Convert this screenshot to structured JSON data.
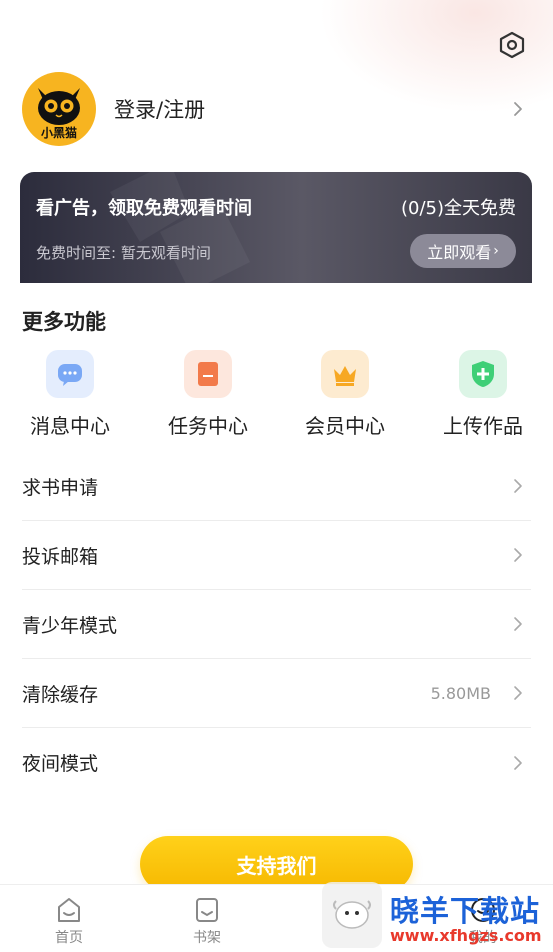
{
  "profile": {
    "avatar_text": "小黑猫",
    "login_label": "登录/注册"
  },
  "icons": {
    "settings": "hexagon-settings-icon",
    "chevron": "chevron-right-icon"
  },
  "ad_card": {
    "title": "看广告，领取免费观看时间",
    "free_count": "(0/5)全天免费",
    "subtitle": "免费时间至: 暂无观看时间",
    "button_label": "立即观看",
    "button_arrow": "›"
  },
  "more_features": {
    "title": "更多功能",
    "items": [
      {
        "label": "消息中心",
        "icon": "message-icon",
        "color": "#7aa8f5",
        "bg": "#e4edfd"
      },
      {
        "label": "任务中心",
        "icon": "task-icon",
        "color": "#f27a4a",
        "bg": "#fde7dd"
      },
      {
        "label": "会员中心",
        "icon": "crown-icon",
        "color": "#f7a823",
        "bg": "#fdebd0"
      },
      {
        "label": "上传作品",
        "icon": "upload-shield-icon",
        "color": "#3fcf77",
        "bg": "#dcf5e6"
      }
    ]
  },
  "menu": [
    {
      "label": "求书申请",
      "value": ""
    },
    {
      "label": "投诉邮箱",
      "value": ""
    },
    {
      "label": "青少年模式",
      "value": ""
    },
    {
      "label": "清除缓存",
      "value": "5.80MB"
    },
    {
      "label": "夜间模式",
      "value": ""
    }
  ],
  "support_button": "支持我们",
  "tabs": [
    {
      "label": "首页",
      "icon": "home-icon"
    },
    {
      "label": "书架",
      "icon": "bookshelf-icon"
    },
    {
      "label": "我的",
      "icon": "profile-icon"
    }
  ],
  "watermark": {
    "text": "晓羊下载站",
    "url": "www.xfhgzs.com"
  },
  "colors": {
    "accent_yellow": "#f7b420",
    "ad_dark": "#2c2c3c",
    "text_primary": "#222222",
    "text_secondary": "#999999"
  }
}
